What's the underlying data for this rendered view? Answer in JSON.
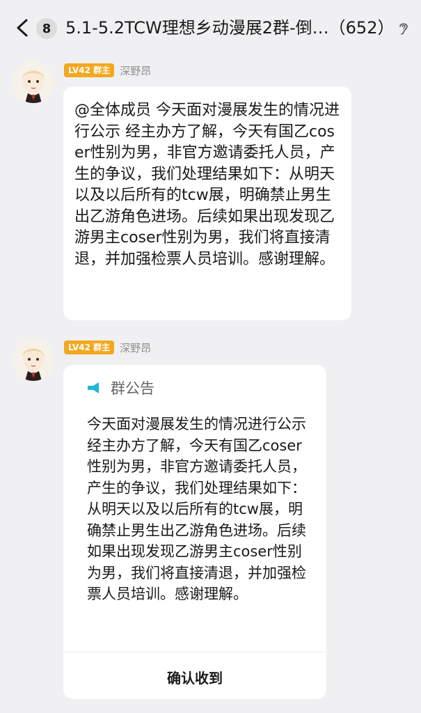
{
  "header": {
    "unread_count": "8",
    "title": "5.1-5.2TCW理想乡动漫展2群-倒…（652）",
    "back_icon": "chevron-left-icon",
    "ear_icon": "ear-icon"
  },
  "messages": [
    {
      "level_badge": "LV42 群主",
      "sender": "深野昂",
      "text": "@全体成员  今天面对漫展发生的情况进行公示 经主办方了解，今天有国乙coser性别为男，非官方邀请委托人员，产生的争议，我们处理结果如下：从明天以及以后所有的tcw展，明确禁止男生出乙游角色进场。后续如果出现发现乙游男主coser性别为男，我们将直接清退，并加强检票人员培训。感谢理解。"
    },
    {
      "level_badge": "LV42 群主",
      "sender": "深野昂",
      "notice": {
        "label": "群公告",
        "icon": "megaphone-icon",
        "text": "今天面对漫展发生的情况进行公示 经主办方了解，今天有国乙coser性别为男，非官方邀请委托人员，产生的争议，我们处理结果如下：从明天以及以后所有的tcw展，明确禁止男生出乙游角色进场。后续如果出现发现乙游男主coser性别为男，我们将直接清退，并加强检票人员培训。感谢理解。",
        "confirm_label": "确认收到"
      }
    }
  ],
  "colors": {
    "background": "#f0f0f2",
    "bubble": "#ffffff",
    "level_badge": "#f3a81e",
    "megaphone": "#1fb8d6"
  }
}
